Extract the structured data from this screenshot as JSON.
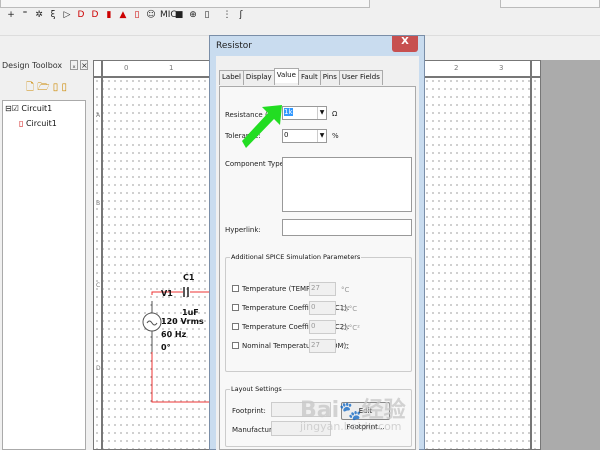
{
  "toolbar": {
    "icons": [
      "+",
      "⁼",
      "✲",
      "ξ",
      "▷",
      "D",
      "D",
      "▮",
      "▲",
      "▯",
      "☺",
      "MIC",
      "■",
      "⊕",
      "▯",
      "⋮",
      "ʃ"
    ]
  },
  "toolbox": {
    "title": "Design Toolbox",
    "pin": "ₓ",
    "close": "×",
    "tree": [
      {
        "label": "Circuit1"
      },
      {
        "label": "Circuit1"
      }
    ]
  },
  "canvas": {
    "ruler_marks": [
      "0",
      "1",
      "2",
      "3"
    ],
    "row_marks": [
      "A",
      "B",
      "C",
      "D"
    ],
    "circuit": {
      "source_name": "V1",
      "source_value": "120 Vrms",
      "source_freq": "60 Hz",
      "source_phase": "0°",
      "cap_name": "C1",
      "cap_value": "1uF"
    }
  },
  "dialog": {
    "title": "Resistor",
    "close": "X",
    "tabs": [
      "Label",
      "Display",
      "Value",
      "Fault",
      "Pins",
      "User Fields"
    ],
    "active_tab": "Value",
    "resistance_label": "Resistance (R):",
    "resistance_value": "1k",
    "resistance_unit": "Ω",
    "tolerance_label": "Tolerance:",
    "tolerance_value": "0",
    "tolerance_unit": "%",
    "component_type_label": "Component Type:",
    "hyperlink_label": "Hyperlink:",
    "spice_group": "Additional SPICE Simulation Parameters",
    "spice_params": [
      {
        "label": "Temperature (TEMP):",
        "value": "27",
        "unit": "°C"
      },
      {
        "label": "Temperature Coefficient (TC1):",
        "value": "0",
        "unit": "Ω/°C"
      },
      {
        "label": "Temperature Coefficient (TC2):",
        "value": "0",
        "unit": "Ω/°C²"
      },
      {
        "label": "Nominal Temperature (TNOM):",
        "value": "27",
        "unit": "°C"
      }
    ],
    "layout_group": "Layout Settings",
    "footprint_label": "Footprint:",
    "manufacturer_label": "Manufacturer:",
    "edit_footprint": "Edit Footprint..."
  },
  "annotation": {
    "arrow_color": "#22dd22"
  },
  "watermark": {
    "logo": "Baidu 经验",
    "url": "jingyan.baidu.com"
  }
}
